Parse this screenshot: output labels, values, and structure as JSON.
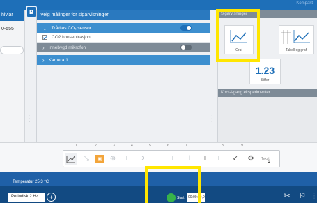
{
  "header": {
    "title": "Kompakt"
  },
  "left_panel": {
    "header": "hivlar",
    "device_code": "0-555"
  },
  "sensor_panel": {
    "header": "Velg målinger for sigarvisninger",
    "rows": [
      {
        "label": "Trådløs CO₂ sensor",
        "toggle": "on"
      },
      {
        "label": "CO2 konsentrasjon",
        "checked": true
      },
      {
        "label": "Innebygd mikrofon",
        "toggle": "off"
      },
      {
        "label": "Kamera 1"
      }
    ]
  },
  "right_panel": {
    "header": "Sigarvisninger",
    "tiles": [
      {
        "caption": "Graf",
        "icon": "line-graph-icon"
      },
      {
        "caption": "Tabell og graf",
        "icon": "table-graph-icon"
      },
      {
        "caption": "Siffer",
        "value": "1.23"
      }
    ],
    "section2": "Kors-i-gang eksperimenter"
  },
  "toolbar": {
    "numbers": [
      "1",
      "2",
      "3",
      "4",
      "5",
      "6",
      "7",
      "8",
      "9"
    ],
    "buttons": [
      "graph-icon",
      "expand-icon",
      "select-icon",
      "zoom-icon",
      "axis-icon",
      "sum-icon",
      "curve-icon",
      "tangent-icon",
      "marker-icon",
      "line-icon",
      "slope-icon",
      "check-icon",
      "settings-icon"
    ],
    "extra_label": "Tekst"
  },
  "status": {
    "temperature": "Temperatur 25,3 °C",
    "frequency": "Periodisk 2 Hz",
    "start_label": "Start",
    "time": "00:00:00,0"
  },
  "colors": {
    "highlight": "#ffe600",
    "brand": "#1e6fb8"
  }
}
